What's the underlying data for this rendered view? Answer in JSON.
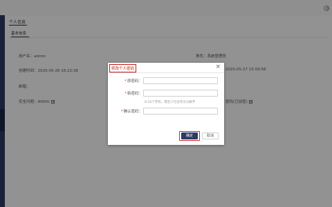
{
  "header": {
    "user_icon": "user-circle-icon"
  },
  "page": {
    "tab_label": "个人信息",
    "subtab_label": "基本信息",
    "fields": {
      "username": "用户名：admin",
      "role": "角色：系统管理员",
      "created_time": "创建时间：2020-05-26 16:22:38",
      "modified_time": "2020-05-27 15:59:58",
      "email": "邮箱：",
      "security_question": "安全问题：AISHU",
      "password_partial": "密码(已加密)"
    }
  },
  "dialog": {
    "title": "修改个人密码",
    "close_glyph": "×",
    "old_password_label": "原密码：",
    "new_password_label": "新密码：",
    "confirm_password_label": "确认密码：",
    "required_mark": "*",
    "password_hint": "8-16个字符，需至少包含英文与数字",
    "confirm_label": "确定",
    "cancel_label": "取消"
  },
  "colors": {
    "accent": "#2d3a63",
    "highlight": "#d42222",
    "required": "#e02020"
  }
}
